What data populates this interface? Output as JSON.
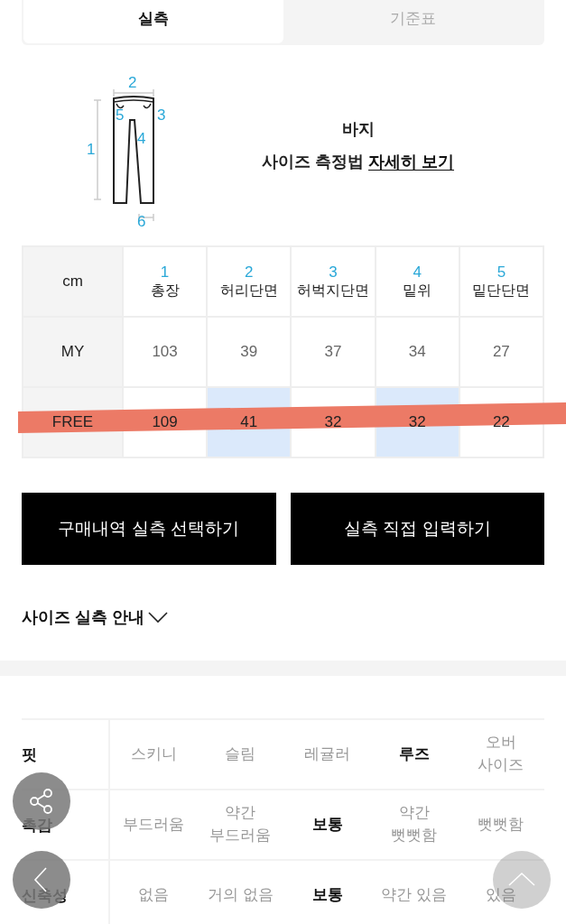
{
  "tabs": [
    {
      "label": "실측",
      "selected": true
    },
    {
      "label": "기준표",
      "selected": false
    }
  ],
  "guide": {
    "diagram_labels": [
      "1",
      "2",
      "3",
      "4",
      "5",
      "6"
    ],
    "title": "바지",
    "text": "사이즈 측정법",
    "link": "자세히 보기"
  },
  "table": {
    "corner": "cm",
    "columns": [
      {
        "number": "1",
        "name": "총장"
      },
      {
        "number": "2",
        "name": "허리단면"
      },
      {
        "number": "3",
        "name": "허벅지단면"
      },
      {
        "number": "4",
        "name": "밑위"
      },
      {
        "number": "5",
        "name": "밑단단면"
      }
    ],
    "rows": [
      {
        "size": "MY",
        "marked": false,
        "values": [
          {
            "text": "103",
            "highlighted": false
          },
          {
            "text": "39",
            "highlighted": false
          },
          {
            "text": "37",
            "highlighted": false
          },
          {
            "text": "34",
            "highlighted": false
          },
          {
            "text": "27",
            "highlighted": false
          }
        ]
      },
      {
        "size": "FREE",
        "marked": true,
        "values": [
          {
            "text": "109",
            "highlighted": false
          },
          {
            "text": "41",
            "highlighted": true
          },
          {
            "text": "32",
            "highlighted": false
          },
          {
            "text": "32",
            "highlighted": true
          },
          {
            "text": "22",
            "highlighted": false
          }
        ]
      }
    ]
  },
  "buttons": [
    "구매내역 실측 선택하기",
    "실측 직접 입력하기"
  ],
  "size_guide_toggle": {
    "label": "사이즈 실측 안내",
    "expanded": false
  },
  "attributes": [
    {
      "label": "핏",
      "options": [
        {
          "text": "스키니",
          "selected": false
        },
        {
          "text": "슬림",
          "selected": false
        },
        {
          "text": "레귤러",
          "selected": false
        },
        {
          "text": "루즈",
          "selected": true
        },
        {
          "text": "오버\n사이즈",
          "selected": false
        }
      ]
    },
    {
      "label": "촉감",
      "options": [
        {
          "text": "부드러움",
          "selected": false
        },
        {
          "text": "약간\n부드러움",
          "selected": false
        },
        {
          "text": "보통",
          "selected": true
        },
        {
          "text": "약간\n뻣뻣함",
          "selected": false
        },
        {
          "text": "뻣뻣함",
          "selected": false
        }
      ]
    },
    {
      "label": "신축성",
      "options": [
        {
          "text": "없음",
          "selected": false
        },
        {
          "text": "거의 없음",
          "selected": false
        },
        {
          "text": "보통",
          "selected": true
        },
        {
          "text": "약간 있음",
          "selected": false
        },
        {
          "text": "있음",
          "selected": false
        }
      ]
    }
  ]
}
